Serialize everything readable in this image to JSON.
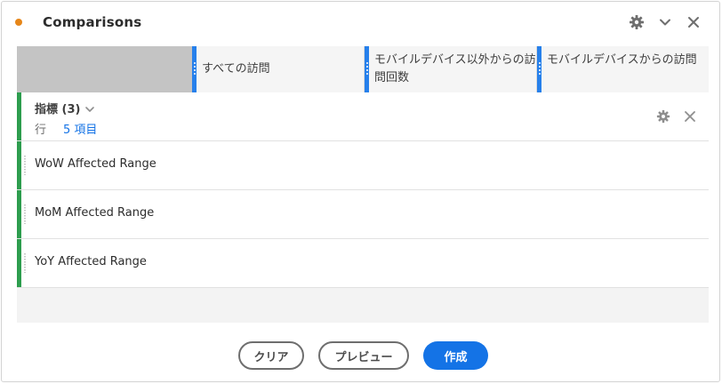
{
  "panel": {
    "title": "Comparisons",
    "status_color": "#e68619",
    "icons": [
      "gear-icon",
      "chevron-down-icon",
      "close-icon"
    ]
  },
  "columns": [
    {
      "label": "すべての訪問"
    },
    {
      "label": "モバイルデバイス以外からの訪問回数"
    },
    {
      "label": "モバイルデバイスからの訪問"
    }
  ],
  "metrics_group": {
    "title": "指標 (3)",
    "rows_label": "行",
    "rows_count": "5 項目"
  },
  "rows": [
    {
      "label": "WoW Affected Range"
    },
    {
      "label": "MoM Affected Range"
    },
    {
      "label": "YoY Affected Range"
    }
  ],
  "footer": {
    "clear_label": "クリア",
    "preview_label": "プレビュー",
    "create_label": "作成"
  },
  "colors": {
    "accent_blue": "#1473e6",
    "column_handle": "#2680eb",
    "row_bar_green": "#2d9d4e"
  }
}
